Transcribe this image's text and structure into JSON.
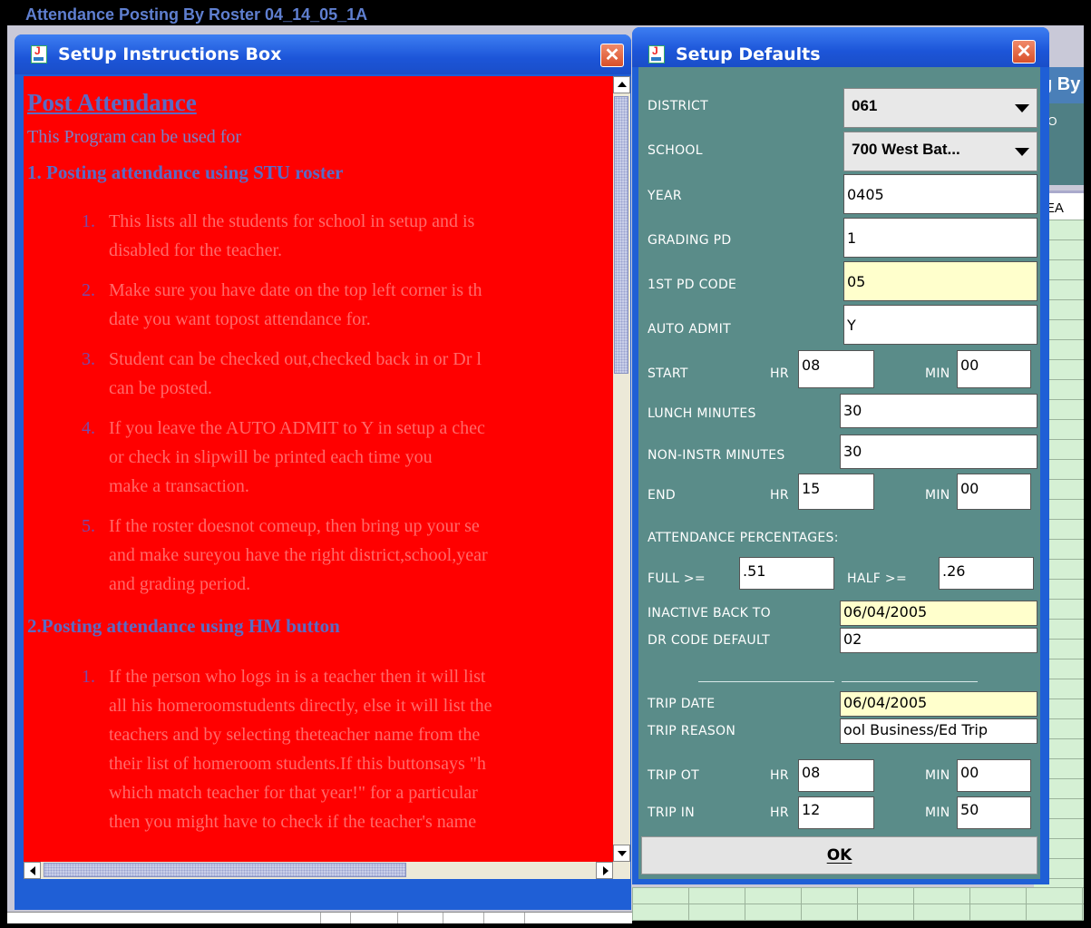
{
  "background_window": {
    "title": "Attendance Posting By Roster 04_14_05_1A",
    "title_fragment": "g By",
    "header_fragment": "CO",
    "column_fragment": "REA"
  },
  "instructions_window": {
    "title": "SetUp Instructions Box",
    "heading": "Post Attendance ",
    "intro": "This Program can be used for",
    "section1": {
      "title": "1. Posting attendance using STU roster",
      "items": [
        {
          "num": "1.",
          "lines": [
            "This lists all the students for school in setup and is",
            "disabled for the teacher."
          ]
        },
        {
          "num": "2.",
          "lines": [
            "Make sure you have date on the top left corner is th",
            "date you want topost attendance for."
          ]
        },
        {
          "num": "3.",
          "lines": [
            "Student can be checked out,checked back in or Dr l",
            "can be posted."
          ]
        },
        {
          "num": "4.",
          "lines": [
            "If you leave the AUTO ADMIT to Y in setup a chec",
            "or check in slipwill be printed each time you",
            "make a transaction."
          ]
        },
        {
          "num": "5.",
          "lines": [
            "If the roster doesnot comeup, then bring up your se",
            "and make sureyou have the right district,school,year",
            "and grading period."
          ]
        }
      ]
    },
    "section2": {
      "title": "2.Posting attendance using HM button",
      "items": [
        {
          "num": "1.",
          "lines": [
            "If the person who logs in is a teacher then it will list",
            "all his homeroomstudents directly, else it will list the",
            "teachers and by selecting theteacher name from the",
            "their list of homeroom students.If this buttonsays \"h",
            "which match teacher for that year!\" for a particular",
            "then you might have to check if the teacher's name"
          ]
        }
      ]
    }
  },
  "setup_window": {
    "title": "Setup Defaults",
    "district_label": "DISTRICT",
    "district_value": "061",
    "school_label": "SCHOOL",
    "school_value": "700 West Bat...",
    "year_label": "YEAR",
    "year_value": "0405",
    "grading_label": "GRADING PD",
    "grading_value": "1",
    "first_pd_label": "1ST PD CODE",
    "first_pd_value": "05",
    "auto_admit_label": "AUTO ADMIT",
    "auto_admit_value": "Y",
    "start_label": "START",
    "start_hr_label": "HR",
    "start_hr_value": "08",
    "start_min_label": "MIN",
    "start_min_value": "00",
    "lunch_label": "LUNCH MINUTES",
    "lunch_value": "30",
    "noninstr_label": "NON-INSTR MINUTES",
    "noninstr_value": "30",
    "end_label": "END",
    "end_hr_label": "HR",
    "end_hr_value": "15",
    "end_min_label": "MIN",
    "end_min_value": "00",
    "percentages_label": "ATTENDANCE PERCENTAGES:",
    "full_label": "FULL  >=",
    "full_value": ".51",
    "half_label": "HALF  >=",
    "half_value": ".26",
    "inactive_label": "INACTIVE BACK TO",
    "inactive_value": "06/04/2005",
    "dr_code_label": "DR CODE DEFAULT",
    "dr_code_value": "02",
    "trip_date_label": "TRIP DATE",
    "trip_date_value": "06/04/2005",
    "trip_reason_label": "TRIP REASON",
    "trip_reason_value": "ool Business/Ed Trip",
    "trip_ot_label": "TRIP OT",
    "trip_ot_hr_label": "HR",
    "trip_ot_hr_value": "08",
    "trip_ot_min_label": "MIN",
    "trip_ot_min_value": "00",
    "trip_in_label": "TRIP IN",
    "trip_in_hr_label": "HR",
    "trip_in_hr_value": "12",
    "trip_in_min_label": "MIN",
    "trip_in_min_value": "50",
    "ok_label": "OK"
  },
  "colors": {
    "titlebar_blue": "#1f5fd6",
    "instructions_bg": "#ff0000",
    "setup_bg": "#5a8c89",
    "highlight_field": "#ffffcc"
  }
}
